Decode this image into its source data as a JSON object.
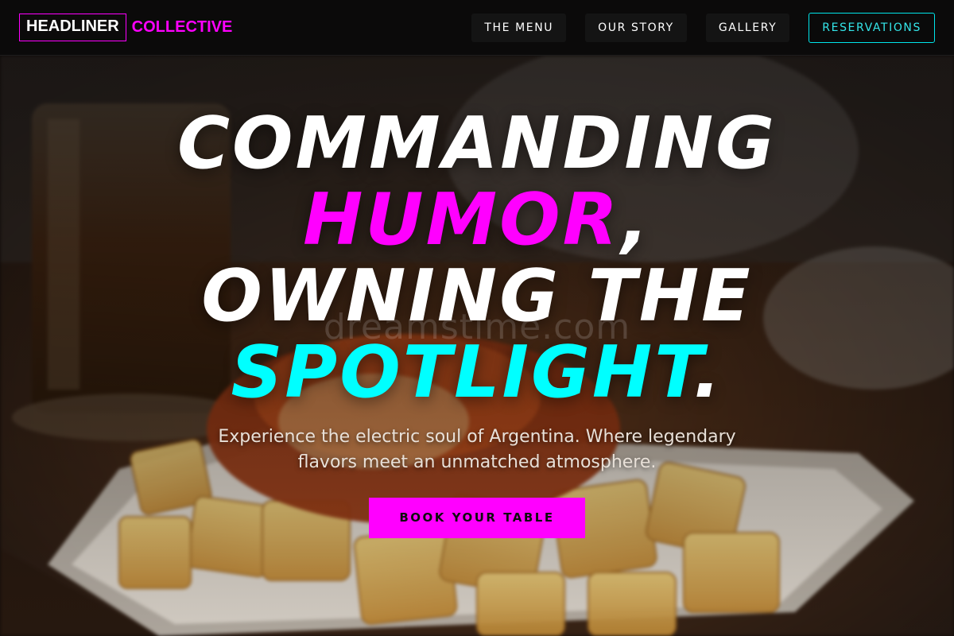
{
  "brand": {
    "name_primary": "HEADLINER",
    "name_accent": "COLLECTIVE"
  },
  "nav": {
    "items": [
      {
        "label": "THE MENU"
      },
      {
        "label": "OUR STORY"
      },
      {
        "label": "GALLERY"
      }
    ],
    "reservations_label": "RESERVATIONS"
  },
  "hero": {
    "headline": {
      "word1": "COMMANDING",
      "word2": "HUMOR",
      "comma": ",",
      "word3": "OWNING THE",
      "word4": "SPOTLIGHT",
      "period": "."
    },
    "subtitle": "Experience the electric soul of Argentina. Where legendary flavors meet an unmatched atmosphere.",
    "cta_label": "BOOK YOUR TABLE",
    "watermark": "dreamstime.com"
  },
  "colors": {
    "accent_magenta": "#ff00ff",
    "accent_cyan": "#00ffff",
    "nav_background": "#0a0a0a"
  },
  "icons": {
    "hero_background": "food-photo-patatas-bravas"
  }
}
